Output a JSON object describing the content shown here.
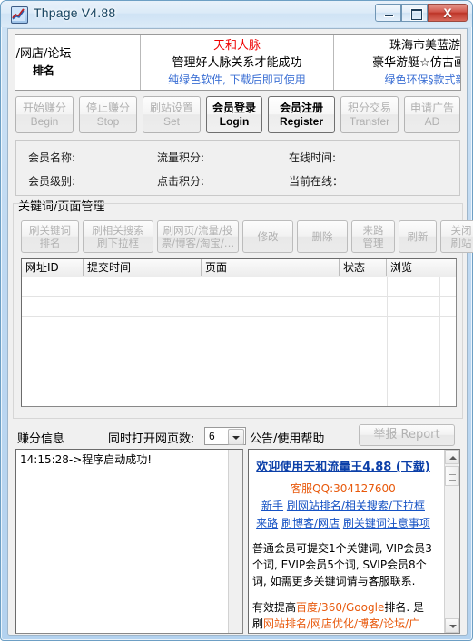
{
  "window": {
    "title": "Thpage V4.88",
    "icon": "chart-line-icon",
    "minimize_label": "Minimize",
    "maximize_label": "Maximize",
    "close_label": "X"
  },
  "ads": [
    {
      "line1": "",
      "line2": "/网店/论坛",
      "line3": "排名",
      "line1_color": "#cc0000",
      "line3_color": "#000000"
    },
    {
      "line1": "天和人脉",
      "line2": "管理好人脉关系才能成功",
      "line3": "纯绿色软件, 下载后即可使用",
      "line1_color": "#ee0000",
      "line3_color": "#3b6fd4"
    },
    {
      "line1": "珠海市美蓝游艇",
      "line2": "豪华游艇☆仿古画舫船",
      "line3": "绿色环保§款式新颖",
      "line1_color": "#000000",
      "line3_color": "#3b6fd4"
    }
  ],
  "toolbar": [
    {
      "cn": "开始赚分",
      "en": "Begin",
      "enabled": false
    },
    {
      "cn": "停止赚分",
      "en": "Stop",
      "enabled": false
    },
    {
      "cn": "刷站设置",
      "en": "Set",
      "enabled": false
    },
    {
      "cn": "会员登录",
      "en": "Login",
      "enabled": true
    },
    {
      "cn": "会员注册",
      "en": "Register",
      "enabled": true
    },
    {
      "cn": "积分交易",
      "en": "Transfer",
      "enabled": false
    },
    {
      "cn": "申请广告",
      "en": "AD",
      "enabled": false
    }
  ],
  "member_info": [
    {
      "label": "会员名称:",
      "value": ""
    },
    {
      "label": "流量积分:",
      "value": ""
    },
    {
      "label": "在线时间:",
      "value": ""
    },
    {
      "label": "会员级别:",
      "value": ""
    },
    {
      "label": "点击积分:",
      "value": ""
    },
    {
      "label": "当前在线：",
      "value": ""
    }
  ],
  "keyword_group": {
    "title": "关键词/页面管理",
    "buttons": [
      {
        "line1": "刷关键词",
        "line2": "排名",
        "enabled": false
      },
      {
        "line1": "刷相关搜索",
        "line2": "刷下拉框",
        "enabled": false
      },
      {
        "line1": "刷网页/流量/投",
        "line2": "票/博客/淘宝/…",
        "enabled": false
      },
      {
        "line1": "修改",
        "line2": "",
        "enabled": false
      },
      {
        "line1": "删除",
        "line2": "",
        "enabled": false
      },
      {
        "line1": "来路",
        "line2": "管理",
        "enabled": false
      },
      {
        "line1": "刷新",
        "line2": "",
        "enabled": false
      },
      {
        "line1": "关闭",
        "line2": "刷站",
        "enabled": false
      }
    ],
    "table": {
      "columns": [
        "网址ID",
        "提交时间",
        "页面",
        "状态",
        "浏览",
        ""
      ],
      "rows": []
    }
  },
  "bottom": {
    "earn_info_label": "赚分信息",
    "pages_label": "同时打开网页数:",
    "pages_value": "6",
    "announce_label": "公告/使用帮助",
    "report_label": "举报 Report",
    "log_text": "14:15:28->程序启动成功!"
  },
  "announcement": {
    "title": "欢迎使用天和流量王4.88 (下载)",
    "qq": "客服QQ:304127600",
    "links_line1": [
      "新手",
      "刷网站排名/相关搜索/下拉框"
    ],
    "links_line2": [
      "来路",
      "刷博客/网店",
      "刷关键词注意事项"
    ],
    "para1": "普通会员可提交1个关键词, VIP会员3个词, EVIP会员5个词, SVIP会员8个词, 如需更多关键词请与客服联系.",
    "para2_pre": "有效提高",
    "para2_hl1": "百度/360/Google",
    "para2_mid": "排名. 是刷",
    "para2_hl2": "网站排名/网店优化/博客/论坛/广告/"
  }
}
